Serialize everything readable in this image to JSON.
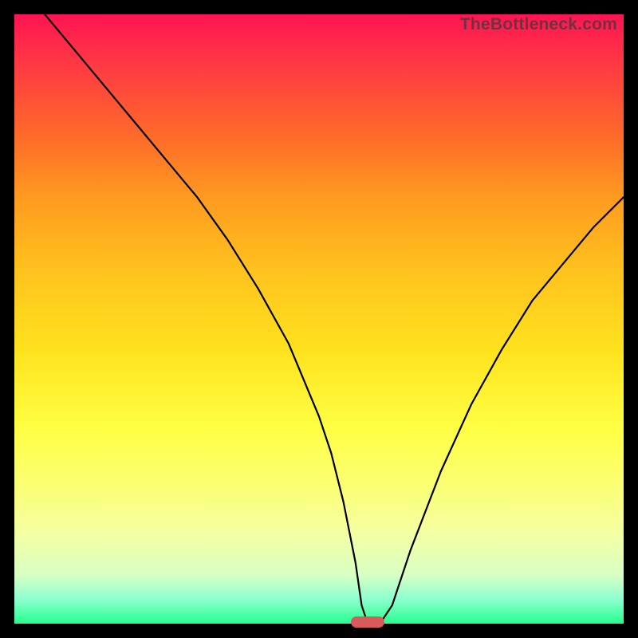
{
  "watermark": {
    "text": "TheBottleneck.com"
  },
  "chart_data": {
    "type": "line",
    "title": "",
    "xlabel": "",
    "ylabel": "",
    "xlim": [
      0,
      100
    ],
    "ylim": [
      0,
      100
    ],
    "legend": false,
    "grid": false,
    "series": [
      {
        "name": "bottleneck-curve",
        "x": [
          5,
          10,
          15,
          20,
          25,
          30,
          35,
          40,
          45,
          50,
          52,
          54,
          56,
          57,
          58,
          60,
          62,
          65,
          70,
          75,
          80,
          85,
          90,
          95,
          100
        ],
        "values": [
          100,
          94,
          88,
          82,
          76,
          70,
          63,
          55,
          46,
          34,
          28,
          20,
          10,
          3,
          0,
          0,
          3,
          12,
          25,
          36,
          45,
          53,
          59,
          65,
          70
        ]
      }
    ],
    "marker": {
      "x_center": 58,
      "y": 0,
      "width_pct": 5.5,
      "color": "#d95a5a"
    },
    "background_gradient": {
      "type": "vertical",
      "stops": [
        {
          "pos": 0.0,
          "color": "#ff1452"
        },
        {
          "pos": 0.2,
          "color": "#ff6a2a"
        },
        {
          "pos": 0.42,
          "color": "#ffc21e"
        },
        {
          "pos": 0.68,
          "color": "#ffff44"
        },
        {
          "pos": 0.92,
          "color": "#d8ffc4"
        },
        {
          "pos": 1.0,
          "color": "#26ff8e"
        }
      ]
    }
  }
}
